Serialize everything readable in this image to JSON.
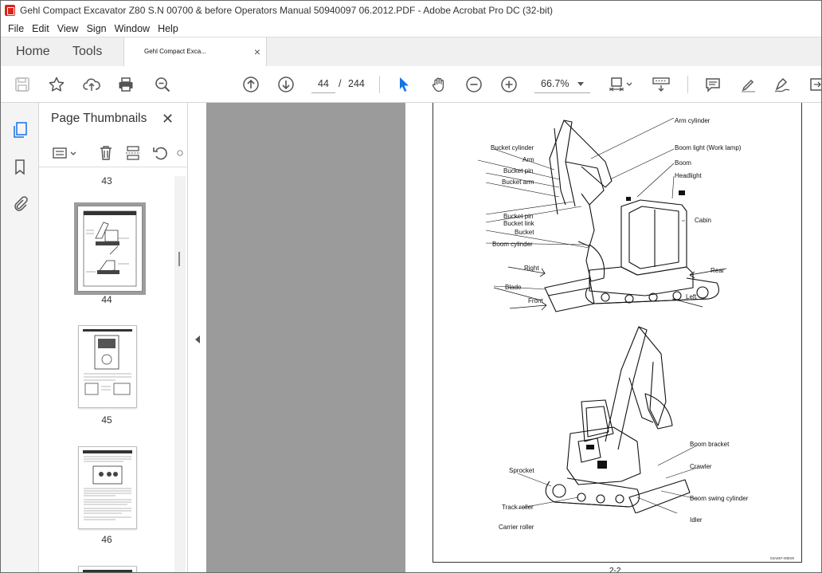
{
  "window": {
    "title": "Gehl Compact Excavator Z80 S.N 00700 & before Operators Manual 50940097 06.2012.PDF - Adobe Acrobat Pro DC (32-bit)"
  },
  "menu": [
    "File",
    "Edit",
    "View",
    "Sign",
    "Window",
    "Help"
  ],
  "tabs": {
    "home": "Home",
    "tools": "Tools",
    "document": "Gehl Compact Exca...",
    "close": "×"
  },
  "toolbar": {
    "current_page": "44",
    "page_sep": "/",
    "total_pages": "244",
    "zoom": "66.7%"
  },
  "thumbnails": {
    "title": "Page Thumbnails",
    "close": "✕",
    "pages": [
      {
        "label": "43"
      },
      {
        "label": "44"
      },
      {
        "label": "45"
      },
      {
        "label": "46"
      }
    ]
  },
  "page": {
    "top_labels": {
      "arm_cylinder": "Arm cylinder",
      "bucket_cylinder": "Bucket cylinder",
      "boom_light": "Boom light (Work lamp)",
      "arm": "Arm",
      "boom": "Boom",
      "bucket_pin_1": "Bucket pin",
      "headlight": "Headlight",
      "bucket_arm": "Bucket arm",
      "cabin": "Cabin",
      "bucket_pin_2": "Bucket pin",
      "bucket_link": "Bucket link",
      "bucket": "Bucket",
      "boom_cylinder": "Boom cylinder",
      "right": "Right",
      "rear": "Rear",
      "blade": "Blade",
      "front": "Front",
      "left": "Left"
    },
    "bottom_labels": {
      "boom_bracket": "Boom bracket",
      "crawler": "Crawler",
      "sprocket": "Sprocket",
      "boom_swing_cylinder": "Boom swing cylinder",
      "track_roller": "Track roller",
      "idler": "Idler",
      "carrier_roller": "Carrier roller"
    },
    "figure_code": "03A697-00E00",
    "page_number": "2-2"
  }
}
